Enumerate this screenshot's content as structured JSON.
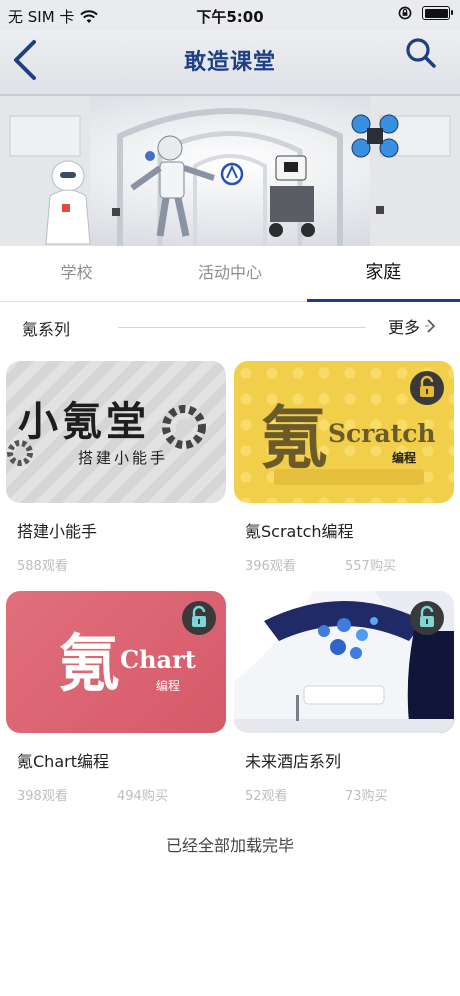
{
  "status_bar": {
    "carrier": "无 SIM 卡",
    "time": "下午5:00"
  },
  "nav": {
    "title": "敢造课堂"
  },
  "tabs": [
    {
      "label": "学校",
      "active": false
    },
    {
      "label": "活动中心",
      "active": false
    },
    {
      "label": "家庭",
      "active": true
    }
  ],
  "section": {
    "title": "氪系列",
    "more_label": "更多"
  },
  "cards": [
    {
      "title": "搭建小能手",
      "views": "588观看",
      "buys": "",
      "locked": false,
      "thumb": {
        "big_text": "小氪堂",
        "sub_text": "搭建小能手"
      }
    },
    {
      "title": "氪Scratch编程",
      "views": "396观看",
      "buys": "557购买",
      "locked": true,
      "thumb": {
        "big_char": "氪",
        "word": "Scratch",
        "small": "编程"
      }
    },
    {
      "title": "氪Chart编程",
      "views": "398观看",
      "buys": "494购买",
      "locked": true,
      "thumb": {
        "big_char": "氪",
        "word": "Chart",
        "small": "编程"
      }
    },
    {
      "title": "未来酒店系列",
      "views": "52观看",
      "buys": "73购买",
      "locked": true
    }
  ],
  "footer": {
    "text": "已经全部加载完毕"
  },
  "colors": {
    "accent": "#1d3f86",
    "scratch_bg": "#f2cf4a",
    "chart_bg": "#dc6674",
    "lock_dark": "#3a3a3a",
    "lock_teal": "#7fd6d6",
    "lock_gold": "#e9b93b"
  }
}
